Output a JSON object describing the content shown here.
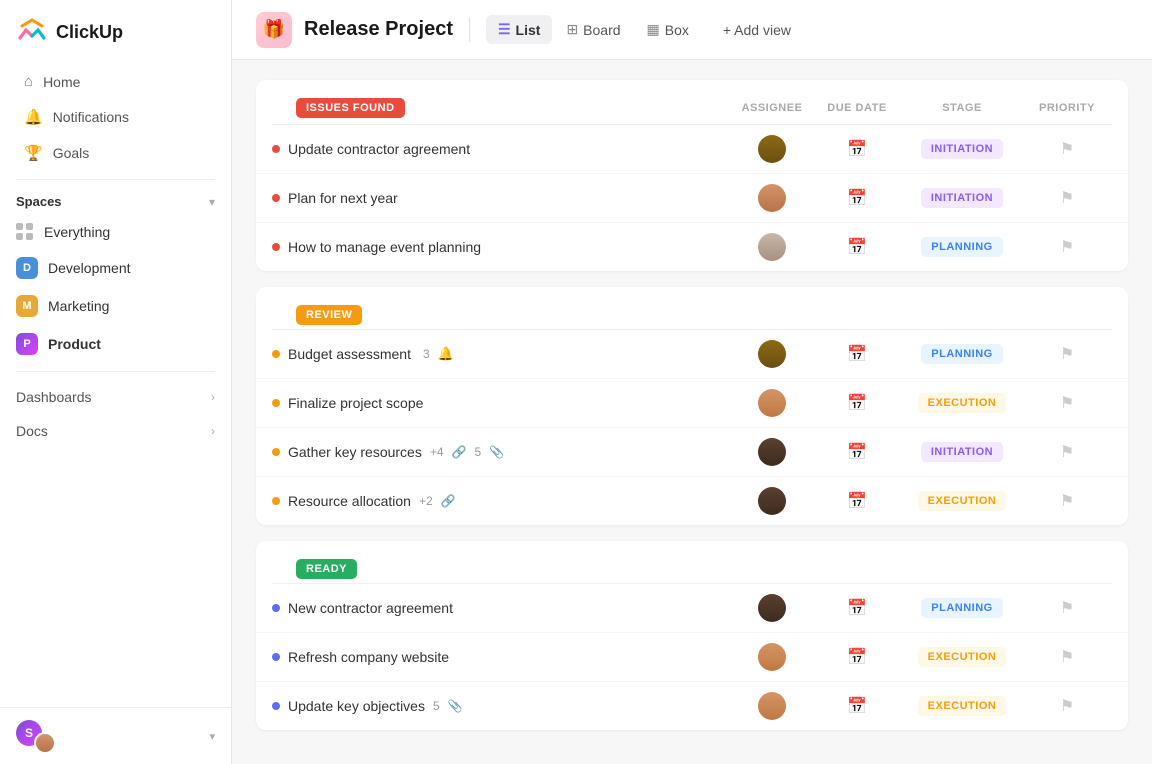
{
  "sidebar": {
    "logo_text": "ClickUp",
    "nav": {
      "home_label": "Home",
      "notifications_label": "Notifications",
      "goals_label": "Goals"
    },
    "spaces_label": "Spaces",
    "spaces": [
      {
        "id": "everything",
        "label": "Everything",
        "badge": null
      },
      {
        "id": "development",
        "label": "Development",
        "badge": "D",
        "badge_class": "badge-d"
      },
      {
        "id": "marketing",
        "label": "Marketing",
        "badge": "M",
        "badge_class": "badge-m"
      },
      {
        "id": "product",
        "label": "Product",
        "badge": "P",
        "badge_class": "badge-p",
        "bold": true
      }
    ],
    "dashboards_label": "Dashboards",
    "docs_label": "Docs",
    "user": {
      "initial": "S"
    }
  },
  "topbar": {
    "project_title": "Release Project",
    "project_icon": "🎁",
    "views": [
      {
        "id": "list",
        "label": "List",
        "active": true,
        "icon": "☰"
      },
      {
        "id": "board",
        "label": "Board",
        "active": false,
        "icon": "⊞"
      },
      {
        "id": "box",
        "label": "Box",
        "active": false,
        "icon": "▦"
      }
    ],
    "add_view_label": "+ Add view"
  },
  "columns": {
    "assignee": "ASSIGNEE",
    "due_date": "DUE DATE",
    "stage": "STAGE",
    "priority": "PRIORITY"
  },
  "groups": [
    {
      "id": "issues_found",
      "label": "ISSUES FOUND",
      "badge_class": "badge-issues",
      "tasks": [
        {
          "name": "Update contractor agreement",
          "dot": "dot-red",
          "stage": "INITIATION",
          "stage_class": "stage-initiation",
          "avatar_class": "avatar-1",
          "meta": []
        },
        {
          "name": "Plan for next year",
          "dot": "dot-red",
          "stage": "INITIATION",
          "stage_class": "stage-initiation",
          "avatar_class": "avatar-2",
          "meta": []
        },
        {
          "name": "How to manage event planning",
          "dot": "dot-red",
          "stage": "PLANNING",
          "stage_class": "stage-planning",
          "avatar_class": "avatar-3",
          "meta": []
        }
      ]
    },
    {
      "id": "review",
      "label": "REVIEW",
      "badge_class": "badge-review",
      "tasks": [
        {
          "name": "Budget assessment",
          "dot": "dot-orange",
          "stage": "PLANNING",
          "stage_class": "stage-planning",
          "avatar_class": "avatar-1",
          "meta": [
            {
              "type": "count",
              "value": "3"
            },
            {
              "type": "icon",
              "value": "🔔"
            }
          ]
        },
        {
          "name": "Finalize project scope",
          "dot": "dot-orange",
          "stage": "EXECUTION",
          "stage_class": "stage-execution",
          "avatar_class": "avatar-5",
          "meta": []
        },
        {
          "name": "Gather key resources",
          "dot": "dot-orange",
          "stage": "INITIATION",
          "stage_class": "stage-initiation",
          "avatar_class": "avatar-4",
          "meta": [
            {
              "type": "count",
              "value": "+4"
            },
            {
              "type": "icon",
              "value": "🔗"
            },
            {
              "type": "count",
              "value": "5"
            },
            {
              "type": "icon",
              "value": "📎"
            }
          ]
        },
        {
          "name": "Resource allocation",
          "dot": "dot-orange",
          "stage": "EXECUTION",
          "stage_class": "stage-execution",
          "avatar_class": "avatar-4",
          "meta": [
            {
              "type": "count",
              "value": "+2"
            },
            {
              "type": "icon",
              "value": "🔗"
            }
          ]
        }
      ]
    },
    {
      "id": "ready",
      "label": "READY",
      "badge_class": "badge-ready",
      "tasks": [
        {
          "name": "New contractor agreement",
          "dot": "dot-blue",
          "stage": "PLANNING",
          "stage_class": "stage-planning",
          "avatar_class": "avatar-4",
          "meta": []
        },
        {
          "name": "Refresh company website",
          "dot": "dot-blue",
          "stage": "EXECUTION",
          "stage_class": "stage-execution",
          "avatar_class": "avatar-5",
          "meta": []
        },
        {
          "name": "Update key objectives",
          "dot": "dot-blue",
          "stage": "EXECUTION",
          "stage_class": "stage-execution",
          "avatar_class": "avatar-5",
          "meta": [
            {
              "type": "count",
              "value": "5"
            },
            {
              "type": "icon",
              "value": "📎"
            }
          ]
        }
      ]
    }
  ]
}
